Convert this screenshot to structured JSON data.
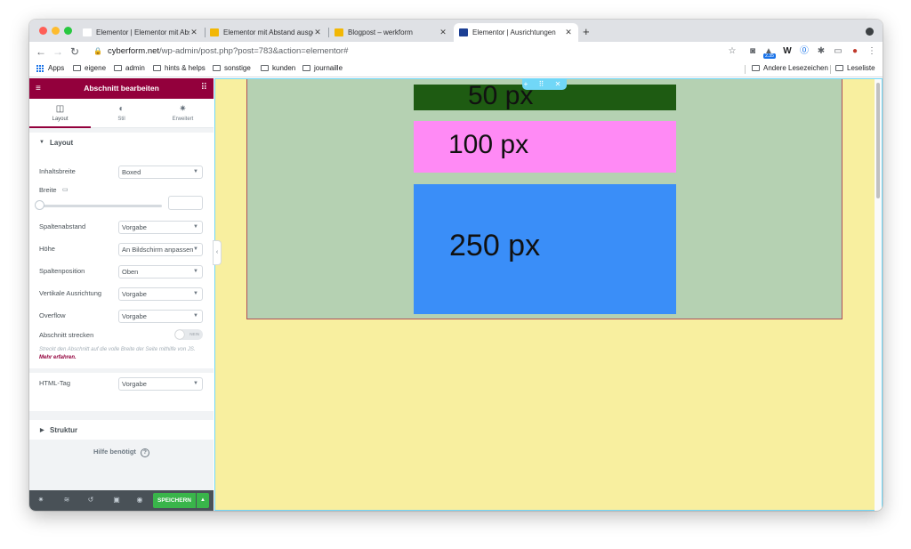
{
  "browser": {
    "tabs": [
      {
        "title": "Elementor | Elementor mit Abst",
        "favicon": "elementor-icon"
      },
      {
        "title": "Elementor mit Abstand ausgeri",
        "favicon": "elementor-icon"
      },
      {
        "title": "Blogpost – werkform",
        "favicon": "elementor-icon"
      },
      {
        "title": "Elementor | Ausrichtungen",
        "favicon": "elementor-icon"
      }
    ],
    "url_host": "cyberform.net",
    "url_path": "/wp-admin/post.php?post=783&action=elementor#",
    "extension_badge": "2.35",
    "bookmarks": [
      "Apps",
      "eigene",
      "admin",
      "hints & helps",
      "sonstige",
      "kunden",
      "journaille"
    ],
    "bookmarks_right": [
      "Andere Lesezeichen",
      "Leseliste"
    ]
  },
  "panel": {
    "title": "Abschnitt bearbeiten",
    "tabs": [
      "Layout",
      "Stil",
      "Erweitert"
    ],
    "layout_section": "Layout",
    "controls": {
      "inhaltsbreite": {
        "label": "Inhaltsbreite",
        "value": "Boxed"
      },
      "breite": {
        "label": "Breite"
      },
      "spaltenabstand": {
        "label": "Spaltenabstand",
        "value": "Vorgabe"
      },
      "hoehe": {
        "label": "Höhe",
        "value": "An Bildschirm anpassen"
      },
      "spaltenposition": {
        "label": "Spaltenposition",
        "value": "Oben"
      },
      "vertikale": {
        "label": "Vertikale Ausrichtung",
        "value": "Vorgabe"
      },
      "overflow": {
        "label": "Overflow",
        "value": "Vorgabe"
      },
      "strecken": {
        "label": "Abschnitt strecken",
        "toggle": "NEIN"
      },
      "hint": "Streckt den Abschnitt auf die volle Breite der Seite mithilfe von JS.",
      "hint_link": "Mehr erfahren.",
      "html_tag": {
        "label": "HTML-Tag",
        "value": "Vorgabe"
      }
    },
    "struktur_section": "Struktur",
    "help": "Hilfe benötigt",
    "save_label": "SPEICHERN"
  },
  "canvas": {
    "blocks": [
      {
        "label": "50 px",
        "color": "#1e5b12"
      },
      {
        "label": "100 px",
        "color": "#ff8af5"
      },
      {
        "label": "250 px",
        "color": "#3a8ef8"
      }
    ],
    "colors": {
      "page_bg": "#f8ef9f",
      "section_bg": "#b5d1b2",
      "accent": "#93003c",
      "handle": "#71d7f7",
      "save": "#39b54a"
    }
  }
}
